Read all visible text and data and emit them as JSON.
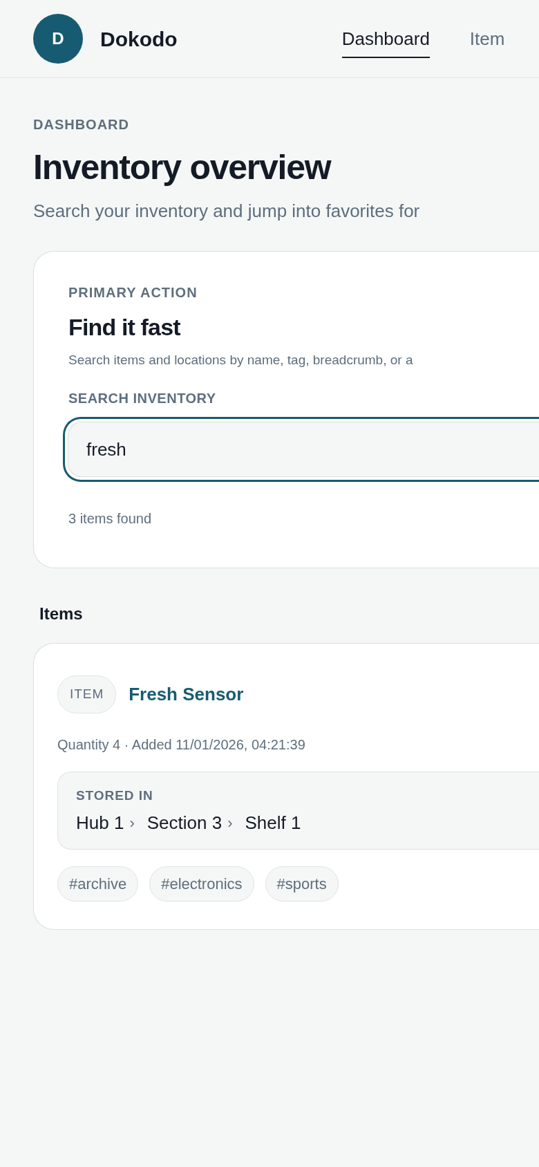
{
  "app": {
    "logo_letter": "D",
    "name": "Dokodo"
  },
  "nav": [
    {
      "label": "Dashboard",
      "selected": true
    },
    {
      "label": "Item",
      "selected": false
    }
  ],
  "page": {
    "eyebrow": "DASHBOARD",
    "title": "Inventory overview",
    "subtitle": "Search your inventory and jump into favorites for"
  },
  "search_card": {
    "eyebrow": "PRIMARY ACTION",
    "title": "Find it fast",
    "description": "Search items and locations by name, tag, breadcrumb, or a",
    "field_label": "SEARCH INVENTORY",
    "value": "fresh",
    "focused": true,
    "result_count": "3 items found"
  },
  "items_section": {
    "heading": "Items",
    "items": [
      {
        "badge": "ITEM",
        "name": "Fresh Sensor",
        "meta": "Quantity 4 · Added 11/01/2026, 04:21:39",
        "location_label": "STORED IN",
        "breadcrumb": [
          "Hub 1",
          "Section 3",
          "Shelf 1"
        ],
        "separator": "›",
        "tags": [
          "#archive",
          "#electronics",
          "#sports"
        ]
      }
    ]
  }
}
